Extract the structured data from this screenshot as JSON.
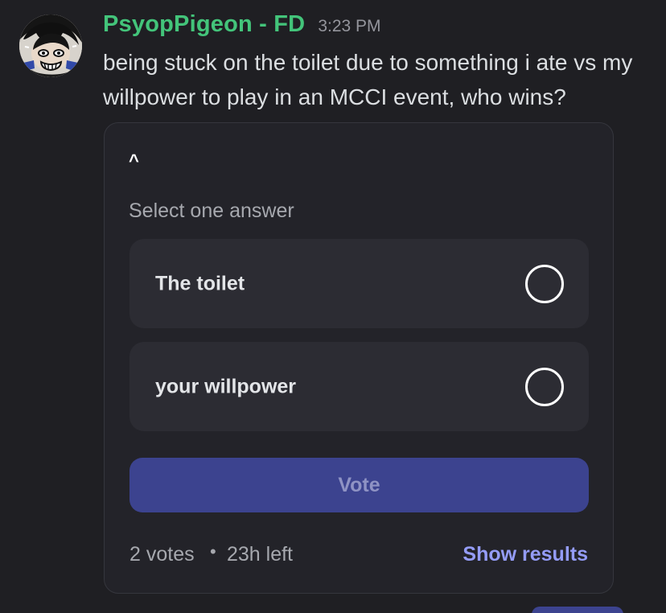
{
  "message": {
    "username": "PsyopPigeon - FD",
    "timestamp": "3:23 PM",
    "content": "being stuck on the toilet due to something i ate vs my willpower to play in an MCCI event, who wins?"
  },
  "poll": {
    "question": "^",
    "select_hint": "Select one answer",
    "answers": [
      {
        "label": "The toilet",
        "selected": false
      },
      {
        "label": "your willpower",
        "selected": false
      }
    ],
    "vote_label": "Vote",
    "footer": {
      "votes": "2 votes",
      "separator": "•",
      "time_left": "23h left",
      "show_results_label": "Show results"
    }
  },
  "colors": {
    "background": "#1f1f23",
    "username": "#43c47a",
    "poll_card": "#232329",
    "answer_card": "#2c2c33",
    "vote_button": "#3c438f",
    "link": "#949cf7"
  },
  "icons": {
    "avatar": "anime-character-avatar",
    "radio": "radio-circle-icon"
  }
}
